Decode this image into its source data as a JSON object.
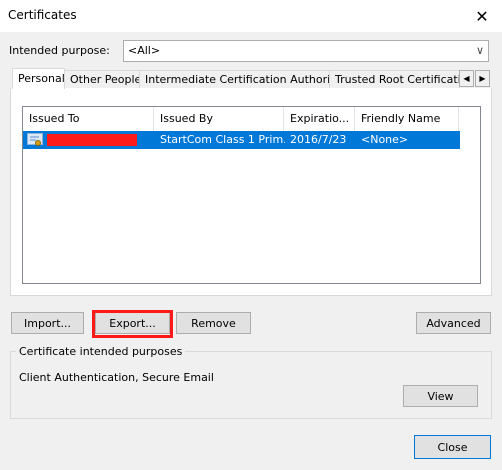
{
  "window": {
    "title": "Certificates",
    "close_glyph": "✕"
  },
  "purpose": {
    "label": "Intended purpose:",
    "value": "<All>"
  },
  "tabs": [
    {
      "label": "Personal"
    },
    {
      "label": "Other People"
    },
    {
      "label": "Intermediate Certification Authorities"
    },
    {
      "label": "Trusted Root Certification Authorities"
    }
  ],
  "list": {
    "columns": [
      "Issued To",
      "Issued By",
      "Expiratio...",
      "Friendly Name"
    ],
    "rows": [
      {
        "issued_to": "",
        "issued_by": "StartCom Class 1 Prim...",
        "expiration": "2016/7/23",
        "friendly_name": "<None>"
      }
    ]
  },
  "buttons": {
    "import": "Import...",
    "export": "Export...",
    "remove": "Remove",
    "advanced": "Advanced",
    "view": "View",
    "close": "Close"
  },
  "purposes_group": {
    "label": "Certificate intended purposes",
    "text": "Client Authentication, Secure Email"
  },
  "icons": {
    "certificate": "certificate-icon",
    "combo_arrow": "chevron-down-icon",
    "tab_left": "tab-scroll-left-icon",
    "tab_right": "tab-scroll-right-icon"
  },
  "colors": {
    "selection": "#0078d7",
    "highlight": "#ff1a1a"
  }
}
